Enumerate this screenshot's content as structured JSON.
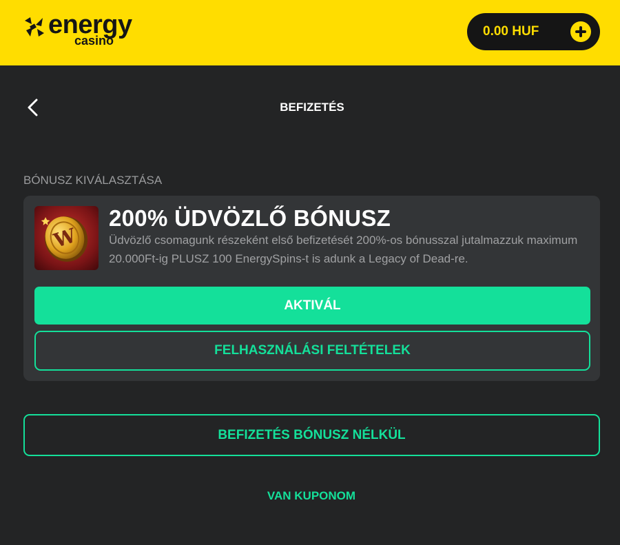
{
  "header": {
    "logo": {
      "word_energy": "energy",
      "word_casino": "casino",
      "icon": "energy-spark-icon",
      "color": "#151515"
    },
    "balance": {
      "amount": "0.00 HUF",
      "icon": "plus-circle-icon"
    },
    "background_color": "#ffdd00"
  },
  "nav": {
    "back_icon": "chevron-left-icon",
    "title": "BEFIZETÉS"
  },
  "bonus_section": {
    "label": "BÓNUSZ KIVÁLASZTÁSA",
    "card": {
      "thumbnail_icon": "wild-coin-icon",
      "title": "200% ÜDVÖZLŐ BÓNUSZ",
      "description": "Üdvözlő csomagunk részeként első befizetését 200%-os bónusszal jutalmazzuk maximum 20.000Ft-ig PLUSZ 100 EnergySpins-t is adunk a Legacy of Dead-re.",
      "activate_label": "AKTIVÁL",
      "terms_label": "FELHASZNÁLÁSI FELTÉTELEK"
    }
  },
  "actions": {
    "no_bonus_label": "BEFIZETÉS BÓNUSZ NÉLKÜL",
    "coupon_label": "VAN KUPONOM"
  },
  "colors": {
    "accent": "#14e09a",
    "brand_yellow": "#ffdd00",
    "page_background": "#232425",
    "card_background": "#333537",
    "muted_text": "#9a9b9d"
  }
}
